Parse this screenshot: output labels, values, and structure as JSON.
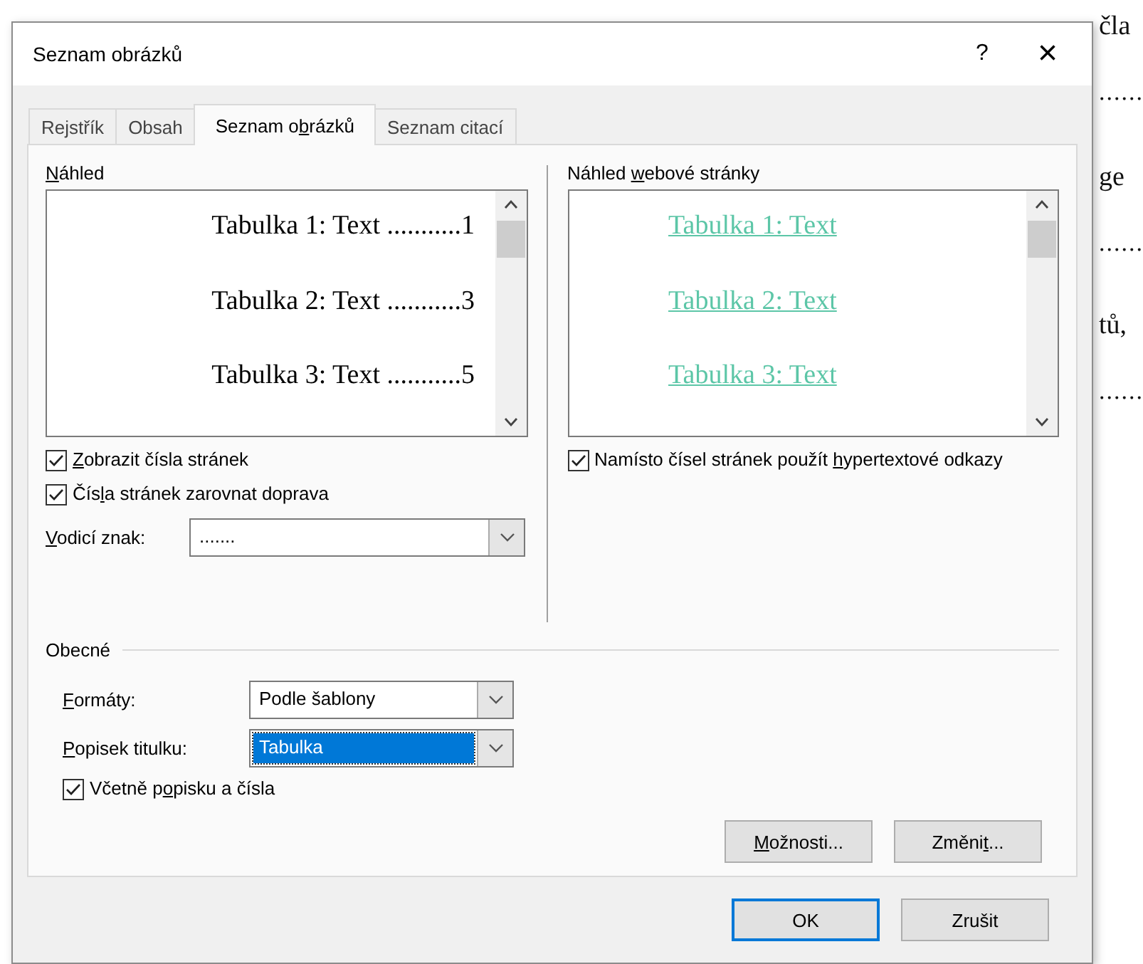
{
  "document": {
    "fragments": [
      {
        "text": "čla",
        "kind": "word"
      },
      {
        "text": "......",
        "kind": "leader"
      },
      {
        "text": "ge",
        "kind": "word"
      },
      {
        "text": "......",
        "kind": "leader"
      },
      {
        "text": "tů,",
        "kind": "word"
      },
      {
        "text": "......",
        "kind": "leader"
      }
    ]
  },
  "window": {
    "title": "Seznam obrázků",
    "help": "?",
    "close": "×"
  },
  "tabs": [
    {
      "label": {
        "before": "Rejstřík"
      },
      "selected": false
    },
    {
      "label": {
        "before": "Obsah"
      },
      "selected": false
    },
    {
      "label": {
        "before": "Seznam o",
        "key": "b",
        "after": "rázků"
      },
      "selected": true
    },
    {
      "label": {
        "before": "Seznam citací"
      },
      "selected": false
    }
  ],
  "print_preview": {
    "label": {
      "key": "N",
      "after": "áhled"
    },
    "entries": [
      "Tabulka 1: Text ...........1",
      "Tabulka 2: Text ...........3",
      "Tabulka 3: Text ...........5"
    ],
    "options": [
      {
        "label": {
          "key": "Z",
          "after": "obrazit čísla stránek"
        },
        "checked": true
      },
      {
        "label": {
          "before": "Čís",
          "key": "l",
          "after": "a stránek zarovnat doprava"
        },
        "checked": true
      }
    ],
    "leader": {
      "label": {
        "key": "V",
        "after": "odicí znak:"
      },
      "value": "......."
    }
  },
  "web_preview": {
    "label": {
      "before": "Náhled ",
      "key": "w",
      "after": "ebové stránky"
    },
    "entries": [
      "Tabulka 1: Text",
      "Tabulka 2: Text",
      "Tabulka 3: Text"
    ],
    "option": {
      "label": {
        "before": "Namísto čísel stránek použít ",
        "key": "h",
        "after": "ypertextové odkazy"
      },
      "checked": true
    }
  },
  "general": {
    "title": "Obecné",
    "formats": {
      "label": {
        "key": "F",
        "after": "ormáty:"
      },
      "value": "Podle šablony",
      "selected": false
    },
    "caption": {
      "label": {
        "key": "P",
        "after": "opisek titulku:"
      },
      "value": "Tabulka",
      "selected": true
    },
    "include": {
      "label": {
        "before": "Včetně p",
        "key": "o",
        "after": "pisku a čísla"
      },
      "checked": true
    },
    "buttons": [
      {
        "label": {
          "key": "M",
          "after": "ožnosti..."
        }
      },
      {
        "label": {
          "before": "Změni",
          "key": "t",
          "after": "..."
        }
      }
    ]
  },
  "footer_buttons": [
    {
      "label": "OK",
      "default": true
    },
    {
      "label": "Zrušit",
      "default": false
    }
  ]
}
